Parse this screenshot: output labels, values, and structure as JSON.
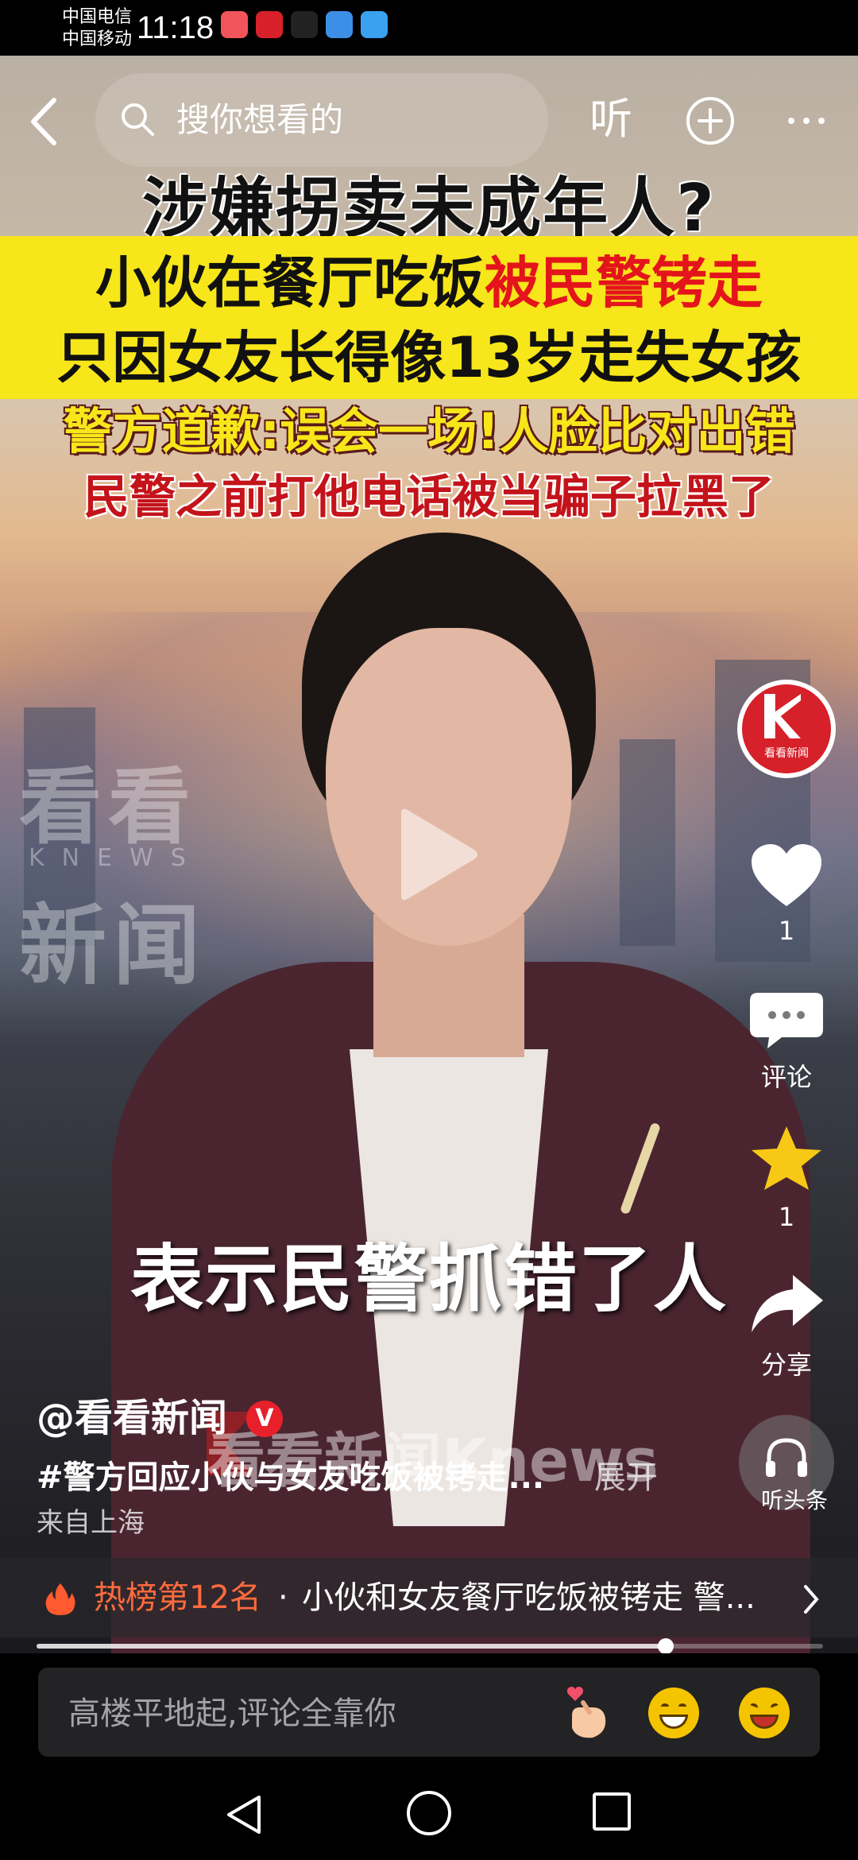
{
  "status_bar": {
    "carrier1": "中国电信",
    "carrier2": "中国移动",
    "time": "11:18",
    "icons": [
      {
        "name": "huawei-store-icon",
        "color": "#f2545b"
      },
      {
        "name": "bank-app-icon",
        "color": "#d8202a"
      },
      {
        "name": "link-app-icon",
        "color": "#222222"
      },
      {
        "name": "browser-icon",
        "color": "#3d8ee6"
      },
      {
        "name": "weather-icon",
        "color": "#3aa0f0"
      }
    ]
  },
  "top_nav": {
    "search_placeholder": "搜你想看的",
    "listen_label": "听"
  },
  "video": {
    "headline_top": "涉嫌拐卖未成年人?",
    "banner_line1_a": "小伙在餐厅吃饭",
    "banner_line1_b": "被民警铐走",
    "banner_line2": "只因女友长得像13岁走失女孩",
    "sub_line1": "警方道歉:误会一场!人脸比对出错",
    "sub_line2": "民警之前打他电话被当骗子拉黑了",
    "watermark_kan": "看看",
    "watermark_knews": "KNEWS",
    "watermark_xin": "新闻",
    "caption": "表示民警抓错了人",
    "watermark_bottom": "看看新闻Knews",
    "accent_red": "#e4141c",
    "banner_yellow": "#f7e61a"
  },
  "right_rail": {
    "channel_name": "看看新闻",
    "like_count": "1",
    "comment_label": "评论",
    "favorite_count": "1",
    "share_label": "分享",
    "listen_news_label": "听头条"
  },
  "post": {
    "author": "@看看新闻",
    "verified": "V",
    "description": "#警方回应小伙与女友吃饭被铐走...",
    "expand_label": "展开",
    "location": "来自上海"
  },
  "hot": {
    "rank": "热榜第12名",
    "separator": "·",
    "title": "小伙和女友餐厅吃饭被铐走 警..."
  },
  "playback": {
    "progress": 0.8
  },
  "comment_bar": {
    "placeholder": "高楼平地起,评论全靠你",
    "emojis": [
      "heart-hand-emoji",
      "grin-emoji",
      "laugh-emoji"
    ]
  }
}
